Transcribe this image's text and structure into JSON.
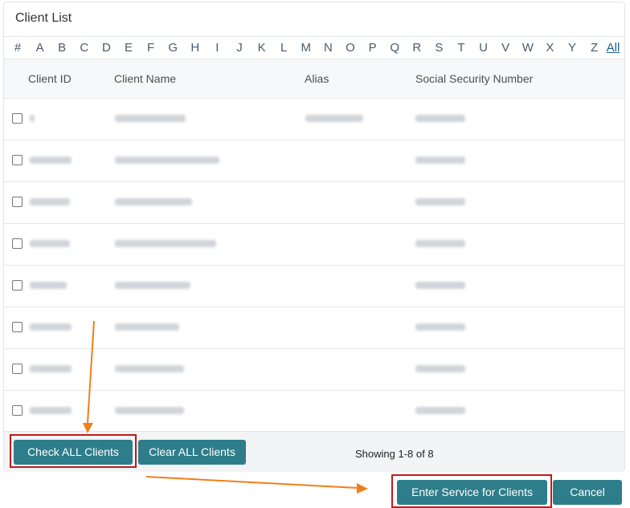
{
  "panel": {
    "title": "Client List"
  },
  "alphabet": [
    "#",
    "A",
    "B",
    "C",
    "D",
    "E",
    "F",
    "G",
    "H",
    "I",
    "J",
    "K",
    "L",
    "M",
    "N",
    "O",
    "P",
    "Q",
    "R",
    "S",
    "T",
    "U",
    "V",
    "W",
    "X",
    "Y",
    "Z",
    "All"
  ],
  "table": {
    "headers": [
      "Client ID",
      "Client Name",
      "Alias",
      "Social Security Number"
    ],
    "rows": [
      {
        "id_redacted": true,
        "name_redacted": true,
        "alias_redacted": true,
        "ssn_redacted": true
      },
      {
        "id_redacted": true,
        "name_redacted": true,
        "alias_redacted": false,
        "ssn_redacted": true
      },
      {
        "id_redacted": true,
        "name_redacted": true,
        "alias_redacted": false,
        "ssn_redacted": true
      },
      {
        "id_redacted": true,
        "name_redacted": true,
        "alias_redacted": false,
        "ssn_redacted": true
      },
      {
        "id_redacted": true,
        "name_redacted": true,
        "alias_redacted": false,
        "ssn_redacted": true
      },
      {
        "id_redacted": true,
        "name_redacted": true,
        "alias_redacted": false,
        "ssn_redacted": true
      },
      {
        "id_redacted": true,
        "name_redacted": true,
        "alias_redacted": false,
        "ssn_redacted": true
      },
      {
        "id_redacted": true,
        "name_redacted": true,
        "alias_redacted": false,
        "ssn_redacted": true
      }
    ]
  },
  "footer": {
    "check_all_label": "Check ALL Clients",
    "clear_all_label": "Clear ALL Clients",
    "showing_text": "Showing 1-8 of 8"
  },
  "actions": {
    "enter_service_label": "Enter Service for Clients",
    "cancel_label": "Cancel"
  },
  "colors": {
    "button": "#2e7d8a",
    "highlight_box": "#c11a1a",
    "annotation_arrow": "#f07f1a"
  }
}
